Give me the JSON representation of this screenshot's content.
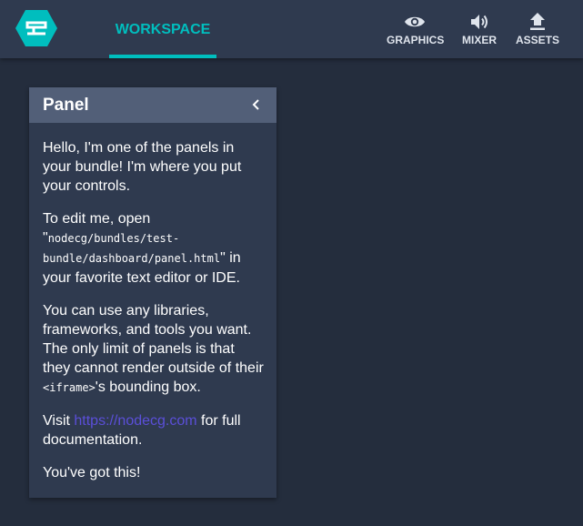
{
  "topbar": {
    "tabs": [
      {
        "label": "WORKSPACE",
        "active": true
      }
    ],
    "nav": [
      {
        "label": "GRAPHICS",
        "icon": "eye-icon"
      },
      {
        "label": "MIXER",
        "icon": "volume-icon"
      },
      {
        "label": "ASSETS",
        "icon": "upload-icon"
      }
    ],
    "logo": "nodecg-logo"
  },
  "panel": {
    "title": "Panel",
    "collapse_icon": "chevron-left-icon",
    "p1": "Hello, I'm one of the panels in your bundle! I'm where you put your controls.",
    "p2_before": "To edit me, open \"",
    "p2_code": "nodecg/bundles/test-bundle/dashboard/panel.html",
    "p2_after": "\" in your favorite text editor or IDE.",
    "p3_before": "You can use any libraries, frameworks, and tools you want. The only limit of panels is that they cannot render outside of their ",
    "p3_code": "<iframe>",
    "p3_after": "'s bounding box.",
    "p4_before": "Visit ",
    "p4_link": "https://nodecg.com",
    "p4_after": " for full documentation.",
    "p5": "You've got this!"
  },
  "colors": {
    "accent": "#00bebe",
    "topbar": "#2f3a4f",
    "background": "#242d3d",
    "panel_header": "#525f78",
    "link": "#5b4fd9"
  }
}
